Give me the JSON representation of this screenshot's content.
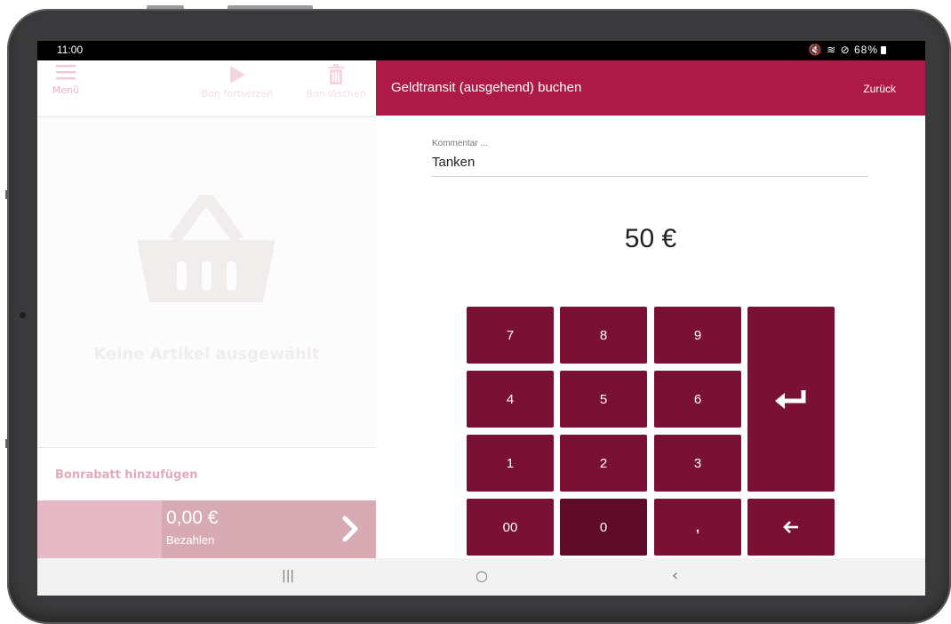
{
  "status_bar": {
    "time": "11:00",
    "icons": "🔇 ≋ ⊘",
    "battery": "68%"
  },
  "toolbar": {
    "menu_label": "Menü",
    "resume_label": "Bon fortsetzen",
    "delete_label": "Bon löschen"
  },
  "cart": {
    "empty_text": "Keine Artikel ausgewählt",
    "discount_label": "Bonrabatt hinzufügen",
    "total": "0,00 €",
    "pay_label": "Bezahlen"
  },
  "header": {
    "title": "Geldtransit (ausgehend) buchen",
    "back_label": "Zurück"
  },
  "comment": {
    "label": "Kommentar ...",
    "value": "Tanken"
  },
  "amount": "50 €",
  "keypad": {
    "k7": "7",
    "k8": "8",
    "k9": "9",
    "k4": "4",
    "k5": "5",
    "k6": "6",
    "k1": "1",
    "k2": "2",
    "k3": "3",
    "k00": "00",
    "k0": "0",
    "kcomma": ","
  },
  "nav": {
    "recent": "|||",
    "home": "○",
    "back": "‹"
  },
  "colors": {
    "accent": "#ad1a48",
    "key": "#7a1135",
    "key_pressed": "#5e0c28",
    "pay_bar": "#e5b9c5"
  },
  "icons": {
    "menu": "menu-icon",
    "resume": "play-icon",
    "delete": "trash-icon",
    "basket": "basket-icon",
    "pay": "chevron-right-icon",
    "enter": "enter-icon",
    "backspace": "backspace-arrow-icon"
  }
}
